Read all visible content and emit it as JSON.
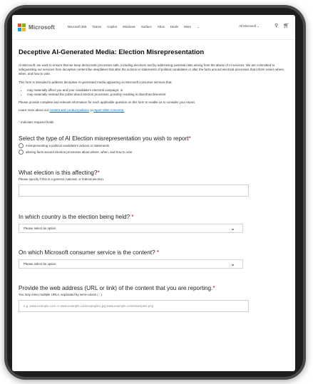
{
  "header": {
    "brand": "Microsoft",
    "nav": [
      "Microsoft 365",
      "Teams",
      "Copilot",
      "Windows",
      "Surface",
      "Xbox",
      "Deals",
      "More"
    ],
    "all_microsoft": "All Microsoft",
    "logo_colors": [
      "#f25022",
      "#7fba00",
      "#00a4ef",
      "#ffb900"
    ]
  },
  "page": {
    "title": "Deceptive AI-Generated Media: Election Misrepresentation",
    "intro": "At Microsoft, we work to ensure that we keep democratic processes safe, including elections and by addressing potential risks arising from the abuse of AI services. We are committed to safeguarding our services from deceptive content like deepfakes that alter the actions or statements of political candidates or alter the facts around electoral processes that inform voters where, when, and how to vote.",
    "form_purpose": "This form is intended to address deceptive AI-generated media appearing on Microsoft consumer services that:",
    "bullets": [
      "may materially affect you and your candidate's electoral campaign; or",
      "may materially mislead the public about election processes, possibly resulting in disenfranchisement"
    ],
    "instructions": "Please provide complete and relevant information for each applicable question on this form to enable us to consider your report.",
    "learn_more_prefix": "Learn more about our",
    "learn_more_link1": "content and conduct policies",
    "learn_more_mid": "or",
    "learn_more_link2": "report other concerns.",
    "required_note": "Indicates required fields",
    "required_star": "*"
  },
  "q1": {
    "label": "Select the type of AI Election misrepresentation you wish to report",
    "options": [
      "misrepresenting a political candidate's actions or statements",
      "altering facts around election processes about where, when, and how to vote"
    ]
  },
  "q2": {
    "label": "What election is this affecting?",
    "helper": "Please specify if this is a general, national, or federal election.",
    "value": ""
  },
  "q3": {
    "label": "In which country is the election being held?",
    "placeholder": "Please select an option"
  },
  "q4": {
    "label": "On which Microsoft consumer service is the content?",
    "placeholder": "Please select an option"
  },
  "q5": {
    "label": "Provide the web address (URL or link) of the content that you are reporting.",
    "helper": "You may enter multiple URLs, separated by semi-colons ( ; ).",
    "placeholder": "e.g. www.example.com or www.example.com/example1.jpg;www.example.com/example2.png"
  }
}
